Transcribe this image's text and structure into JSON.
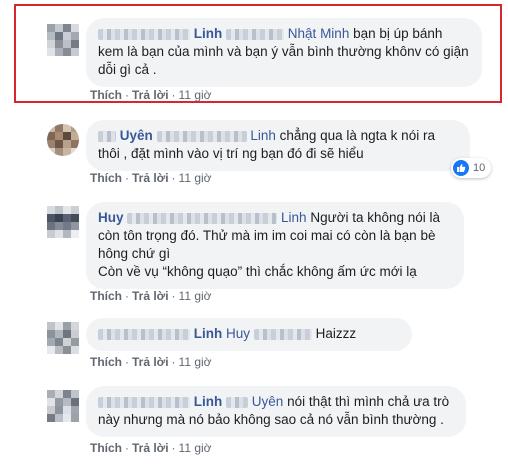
{
  "actions": {
    "like": "Thích",
    "reply": "Trả lời",
    "separator": "·"
  },
  "comments": [
    {
      "author": "Linh",
      "tag": "Nhật Minh",
      "text": " bạn bị úp bánh kem là bạn của mình và bạn ý vẫn bình thường khônv có giận dỗi gì cả .",
      "time": "11 giờ"
    },
    {
      "author": "Uyên",
      "tag": "Linh",
      "text": " chẳng qua là ngta k nói ra thôi , đặt mình vào vị trí ng bạn đó đi sẽ hiểu",
      "time": "11 giờ",
      "reactions": "10"
    },
    {
      "author": "Huy",
      "tag": "Linh",
      "text": " Người ta không nói là còn tôn trọng đó. Thử mà im im coi mai có còn là bạn bè hông chứ gì",
      "text2": "Còn về vụ “không quạo” thì chắc không ấm ức mới lạ",
      "time": "11 giờ"
    },
    {
      "author": "Linh",
      "tag": "Huy",
      "text": " Haizzz",
      "time": "11 giờ"
    },
    {
      "author": "Linh",
      "tag": "Uyên",
      "text": " nói thật thì mình chả ưa trò này nhưng mà nó bảo không sao cả nó vẫn bình thường .",
      "time": "11 giờ"
    }
  ],
  "colors": {
    "name": "#385898",
    "highlight": "#d8262c",
    "bubble": "#f2f3f5",
    "like": "#1877f2"
  },
  "icons": {
    "reaction": "like-icon"
  }
}
